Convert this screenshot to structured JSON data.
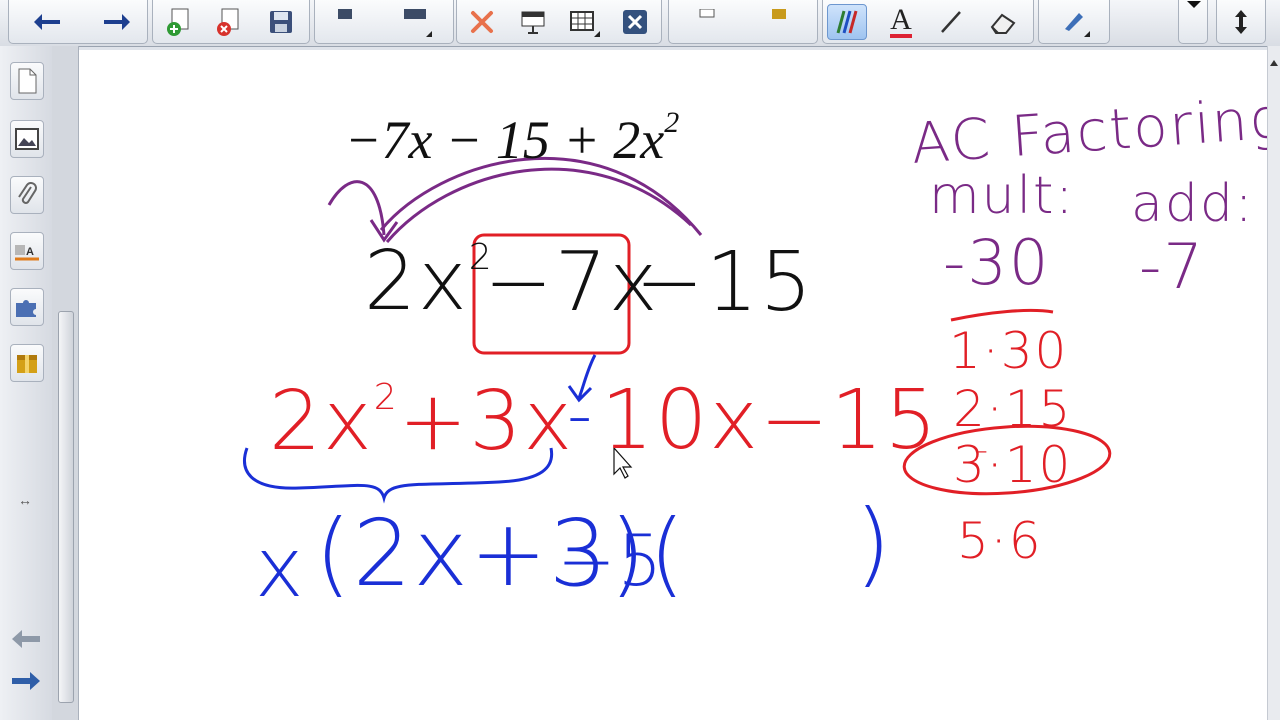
{
  "toolbar": {
    "buttons": [
      {
        "name": "back-button",
        "icon": "arrow-left-icon"
      },
      {
        "name": "forward-button",
        "icon": "arrow-right-icon"
      },
      {
        "name": "add-page-button",
        "icon": "add-page-icon"
      },
      {
        "name": "delete-page-button",
        "icon": "delete-page-icon"
      },
      {
        "name": "save-button",
        "icon": "save-icon"
      },
      {
        "name": "paste-button",
        "icon": "paste-icon"
      },
      {
        "name": "screen-button",
        "icon": "monitor-icon"
      },
      {
        "name": "delete-button",
        "icon": "x-icon"
      },
      {
        "name": "screen-shade-button",
        "icon": "screen-shade-icon"
      },
      {
        "name": "insert-table-button",
        "icon": "table-icon"
      },
      {
        "name": "close-button",
        "icon": "close-box-icon"
      },
      {
        "name": "pens-button",
        "icon": "pens-icon"
      },
      {
        "name": "text-button",
        "icon": "text-icon",
        "label": "A"
      },
      {
        "name": "line-button",
        "icon": "line-icon"
      },
      {
        "name": "eraser-button",
        "icon": "eraser-icon"
      },
      {
        "name": "fill-button",
        "icon": "pen-icon"
      },
      {
        "name": "move-toolbar-button",
        "icon": "up-down-arrow-icon"
      }
    ]
  },
  "sidebar": {
    "tabs": [
      {
        "name": "page-sorter-tab",
        "icon": "page-icon"
      },
      {
        "name": "gallery-tab",
        "icon": "image-icon"
      },
      {
        "name": "attachments-tab",
        "icon": "paperclip-icon"
      },
      {
        "name": "properties-tab",
        "icon": "properties-icon"
      },
      {
        "name": "addons-tab",
        "icon": "puzzle-icon"
      },
      {
        "name": "lesson-tab",
        "icon": "gift-icon"
      }
    ],
    "bottom": [
      {
        "name": "prev-page-button",
        "icon": "arrow-left-icon"
      },
      {
        "name": "next-page-button",
        "icon": "arrow-right-icon"
      }
    ]
  },
  "canvas": {
    "typed_expression": {
      "parts": [
        "−7x − 15 + 2x",
        "2"
      ]
    },
    "rewritten": {
      "lead": "2x",
      "exp": "2",
      "boxed": "−7x",
      "tail": "−15"
    },
    "split_line": {
      "red_part": "2x",
      "red_exp": "2",
      "red_rest": "+3x",
      "minus": "-",
      "tail": "10x−15"
    },
    "factored": {
      "x": "x",
      "group": "(2x+3)",
      "minus5": "−5",
      "open": "(",
      "close": ")"
    },
    "side": {
      "title": "AC Factoring",
      "mult_label": "mult:",
      "add_label": "add:",
      "product": "-30",
      "sum": "-7",
      "pairs": [
        "1·30",
        "2·15",
        "3·10",
        "5·6"
      ],
      "circled_pair_minus": "-"
    }
  },
  "colors": {
    "purple": "#7a2a86",
    "red": "#e11f26",
    "blue": "#1a2fd6",
    "black": "#111111"
  }
}
